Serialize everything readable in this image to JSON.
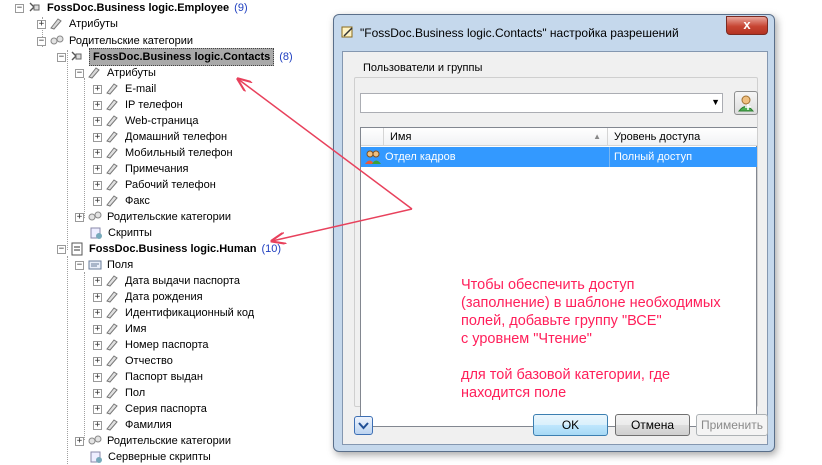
{
  "tree": {
    "employee": {
      "label": "FossDoc.Business logic.Employee",
      "count": "(9)"
    },
    "employee_attrs": "Атрибуты",
    "employee_parents": "Родительские категории",
    "contacts": {
      "label": "FossDoc.Business logic.Contacts",
      "count": "(8)"
    },
    "contacts_attrs": "Атрибуты",
    "contact_fields": [
      "E-mail",
      "IP телефон",
      "Web-страница",
      "Домашний телефон",
      "Мобильный телефон",
      "Примечания",
      "Рабочий телефон",
      "Факс"
    ],
    "contacts_parents": "Родительские категории",
    "contacts_scripts": "Скрипты",
    "human": {
      "label": "FossDoc.Business logic.Human",
      "count": "(10)"
    },
    "human_fields_label": "Поля",
    "human_fields": [
      "Дата выдачи паспорта",
      "Дата рождения",
      "Идентификационный код",
      "Имя",
      "Номер паспорта",
      "Отчество",
      "Паспорт выдан",
      "Пол",
      "Серия паспорта",
      "Фамилия"
    ],
    "human_parents": "Родительские категории",
    "human_server_scripts": "Серверные скрипты"
  },
  "dialog": {
    "title": "\"FossDoc.Business logic.Contacts\" настройка разрешений",
    "close_label": "x",
    "group_label": "Пользователи и группы",
    "combo_value": "",
    "columns": [
      "Имя",
      "Уровень доступа"
    ],
    "rows": [
      {
        "name": "Отдел кадров",
        "access": "Полный доступ"
      }
    ],
    "buttons": {
      "ok": "OK",
      "cancel": "Отмена",
      "apply": "Применить"
    }
  },
  "annotation": {
    "lines": [
      "Чтобы обеспечить доступ",
      "(заполнение) в шаблоне необходимых",
      "полей, добавьте группу \"ВСЕ\"",
      "с уровнем \"Чтение\""
    ],
    "lines2": [
      "для той базовой категории, где",
      "находится поле"
    ]
  },
  "colors": {
    "annotation": "#ff1f5a",
    "selection": "#3399ff",
    "count": "#2040c0"
  }
}
